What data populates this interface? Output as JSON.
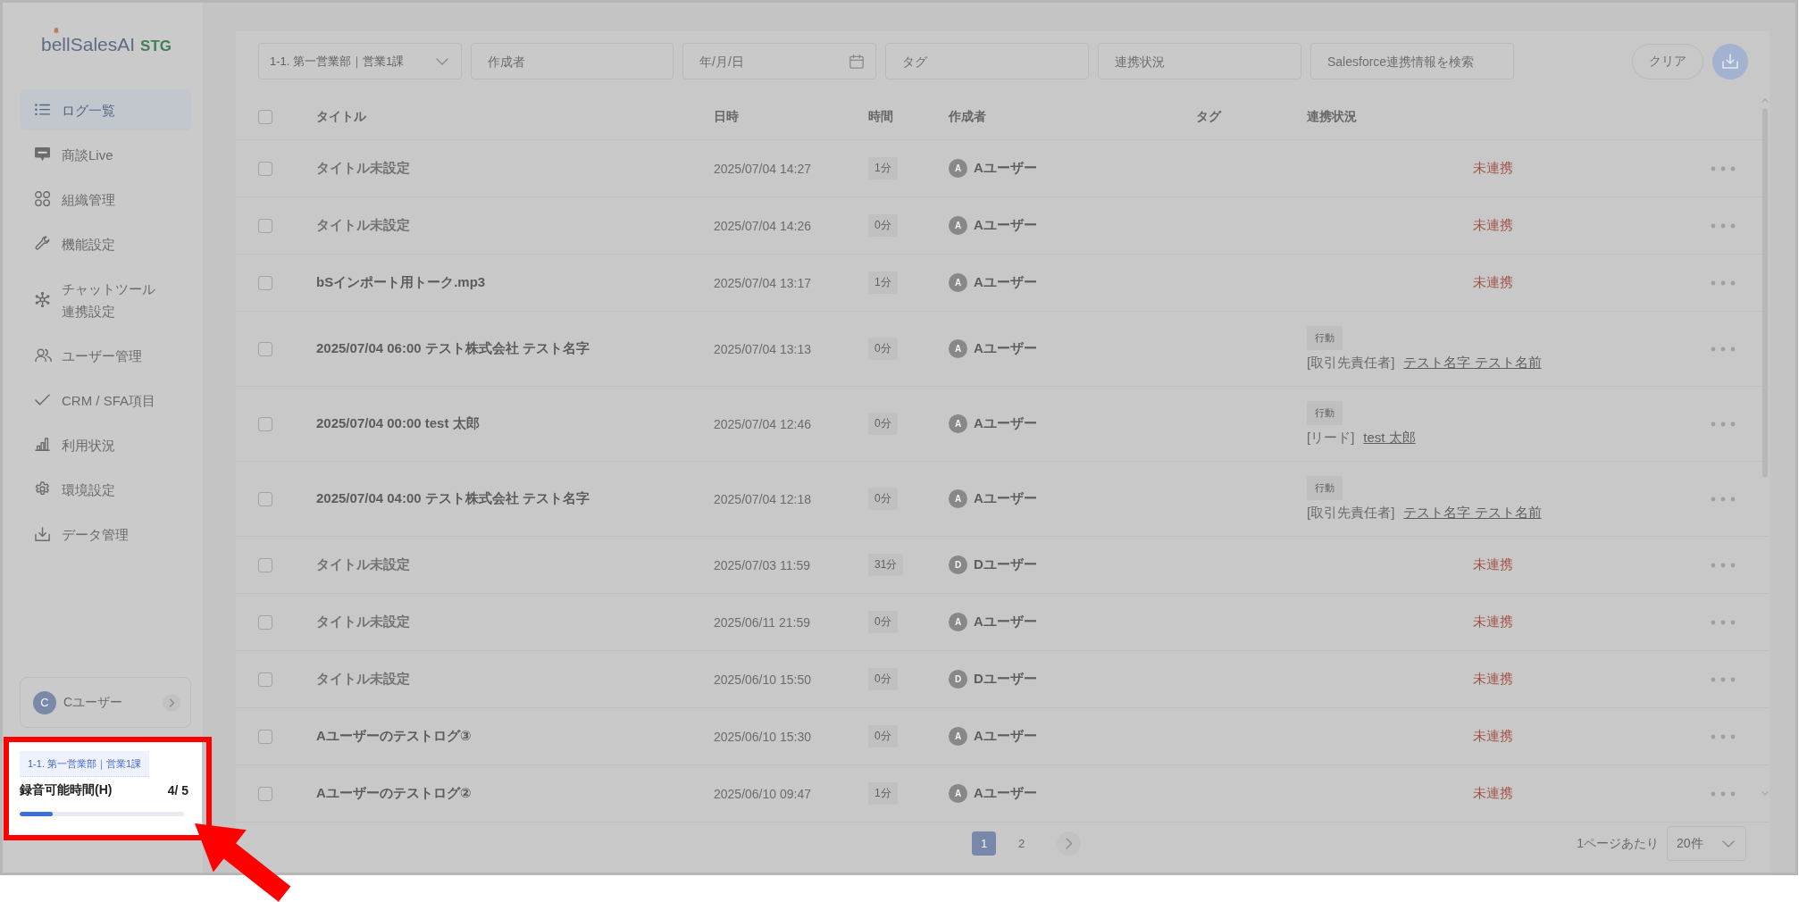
{
  "sidebar": {
    "logo": {
      "name": "bellSalesAI",
      "environment": "STG"
    },
    "nav": [
      {
        "label": "ログ一覧",
        "selected": true
      },
      {
        "label": "商談Live",
        "selected": false
      },
      {
        "label": "組織管理",
        "selected": false
      },
      {
        "label": "機能設定",
        "selected": false
      },
      {
        "label": "チャットツール連携設定",
        "selected": false
      },
      {
        "label": "ユーザー管理",
        "selected": false
      },
      {
        "label": "CRM / SFA項目",
        "selected": false
      },
      {
        "label": "利用状況",
        "selected": false
      },
      {
        "label": "環境設定",
        "selected": false
      },
      {
        "label": "データ管理",
        "selected": false
      }
    ],
    "user": {
      "initial": "C",
      "name": "Cユーザー"
    },
    "usage": {
      "scope": "1-1. 第一営業部｜営業1課",
      "label": "録音可能時間(H)",
      "value": "4/ 5",
      "level": 0.2
    }
  },
  "filters": {
    "department": "1-1. 第一営業部｜営業1課",
    "author": {
      "placeholder": "作成者"
    },
    "date": {
      "placeholder": "年/月/日"
    },
    "tag": {
      "placeholder": "タグ"
    },
    "sync_status": {
      "placeholder": "連携状況"
    },
    "salesforce": {
      "placeholder": "Salesforce連携情報を検索"
    },
    "clear": "クリア"
  },
  "table": {
    "select_all": {
      "checked": false
    },
    "columns": [
      "タイトル",
      "日時",
      "時間",
      "作成者",
      "タグ",
      "連携状況"
    ],
    "rows": [
      {
        "checked": false,
        "title": "タイトル未設定",
        "untitled": true,
        "date": "2025/07/04 14:27",
        "duration": "1分",
        "author": {
          "initial": "A",
          "name": "Aユーザー"
        },
        "sync": {
          "kind": "status",
          "text": "未連携"
        }
      },
      {
        "checked": false,
        "title": "タイトル未設定",
        "untitled": true,
        "date": "2025/07/04 14:26",
        "duration": "0分",
        "author": {
          "initial": "A",
          "name": "Aユーザー"
        },
        "sync": {
          "kind": "status",
          "text": "未連携"
        }
      },
      {
        "checked": false,
        "title": "bSインポート用トーク.mp3",
        "untitled": false,
        "date": "2025/07/04 13:17",
        "duration": "1分",
        "author": {
          "initial": "A",
          "name": "Aユーザー"
        },
        "sync": {
          "kind": "status",
          "text": "未連携"
        }
      },
      {
        "checked": false,
        "title": "2025/07/04 06:00 テスト株式会社 テスト名字",
        "untitled": false,
        "date": "2025/07/04 13:13",
        "duration": "0分",
        "author": {
          "initial": "A",
          "name": "Aユーザー"
        },
        "sync": {
          "kind": "linked",
          "tag": "行動",
          "object": "[取引先責任者]",
          "name": "テスト名字 テスト名前"
        }
      },
      {
        "checked": false,
        "title": "2025/07/04 00:00 test 太郎",
        "untitled": false,
        "date": "2025/07/04 12:46",
        "duration": "0分",
        "author": {
          "initial": "A",
          "name": "Aユーザー"
        },
        "sync": {
          "kind": "linked",
          "tag": "行動",
          "object": "[リード]",
          "name": "test 太郎"
        }
      },
      {
        "checked": false,
        "title": "2025/07/04 04:00 テスト株式会社 テスト名字",
        "untitled": false,
        "date": "2025/07/04 12:18",
        "duration": "0分",
        "author": {
          "initial": "A",
          "name": "Aユーザー"
        },
        "sync": {
          "kind": "linked",
          "tag": "行動",
          "object": "[取引先責任者]",
          "name": "テスト名字 テスト名前"
        }
      },
      {
        "checked": false,
        "title": "タイトル未設定",
        "untitled": true,
        "date": "2025/07/03 11:59",
        "duration": "31分",
        "author": {
          "initial": "D",
          "name": "Dユーザー"
        },
        "sync": {
          "kind": "status",
          "text": "未連携"
        }
      },
      {
        "checked": false,
        "title": "タイトル未設定",
        "untitled": true,
        "date": "2025/06/11 21:59",
        "duration": "0分",
        "author": {
          "initial": "A",
          "name": "Aユーザー"
        },
        "sync": {
          "kind": "status",
          "text": "未連携"
        }
      },
      {
        "checked": false,
        "title": "タイトル未設定",
        "untitled": true,
        "date": "2025/06/10 15:50",
        "duration": "0分",
        "author": {
          "initial": "D",
          "name": "Dユーザー"
        },
        "sync": {
          "kind": "status",
          "text": "未連携"
        }
      },
      {
        "checked": false,
        "title": "Aユーザーのテストログ③",
        "untitled": false,
        "date": "2025/06/10 15:30",
        "duration": "0分",
        "author": {
          "initial": "A",
          "name": "Aユーザー"
        },
        "sync": {
          "kind": "status",
          "text": "未連携"
        }
      },
      {
        "checked": false,
        "title": "Aユーザーのテストログ②",
        "untitled": false,
        "date": "2025/06/10 09:47",
        "duration": "1分",
        "author": {
          "initial": "A",
          "name": "Aユーザー"
        },
        "sync": {
          "kind": "status",
          "text": "未連携"
        }
      }
    ]
  },
  "pagination": {
    "pages": [
      {
        "label": "1",
        "selected": true
      },
      {
        "label": "2",
        "selected": false
      }
    ],
    "per_page_label": "1ページあたり",
    "per_page": "20件"
  }
}
